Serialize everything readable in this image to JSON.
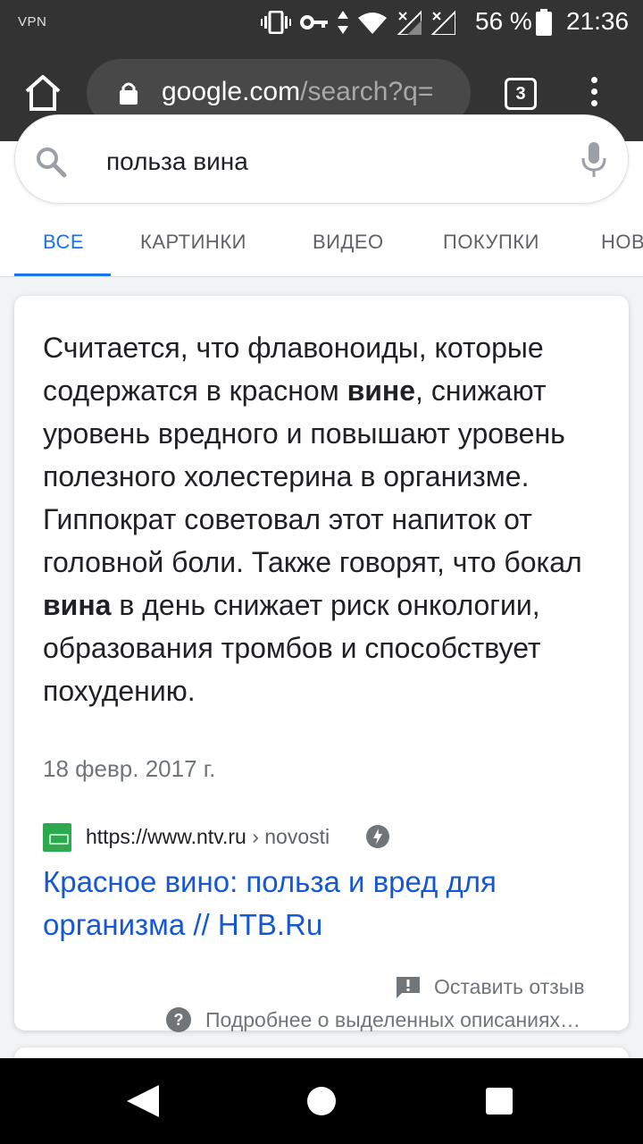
{
  "status_bar": {
    "vpn": "VPN",
    "battery": "56 %",
    "time": "21:36",
    "icons": [
      "vibrate-icon",
      "key-icon",
      "data-arrows-icon",
      "wifi-icon",
      "signal-off-icon",
      "signal-off-icon"
    ]
  },
  "browser": {
    "url_host": "google.com",
    "url_path": "/search?q=",
    "tab_count": "3"
  },
  "search": {
    "query": "польза вина"
  },
  "tabs": [
    {
      "label": "ВСЕ",
      "active": true
    },
    {
      "label": "КАРТИНКИ",
      "active": false
    },
    {
      "label": "ВИДЕО",
      "active": false
    },
    {
      "label": "ПОКУПКИ",
      "active": false
    },
    {
      "label": "НОВ",
      "active": false
    }
  ],
  "snippet": {
    "part1": "Считается, что флавоноиды, которые содержатся в красном ",
    "bold1": "вине",
    "part2": ", снижают уровень вредного и повышают уровень полезного холестерина в организме. Гиппократ советовал этот напиток от головной боли. Также говорят, что бокал ",
    "bold2": "вина",
    "part3": " в день снижает риск онкологии, образования тромбов и способствует похудению.",
    "date": "18 февр. 2017 г."
  },
  "result": {
    "cite_host": "https://www.ntv.ru",
    "cite_path": " › novosti",
    "title": "Красное вино: польза и вред для организма // НТВ.Ru"
  },
  "footer": {
    "feedback": "Оставить отзыв",
    "about": "Подробнее о выделенных описаниях…"
  },
  "colors": {
    "accent": "#1a73e8",
    "link": "#1558d6",
    "toolbar": "#333333"
  }
}
